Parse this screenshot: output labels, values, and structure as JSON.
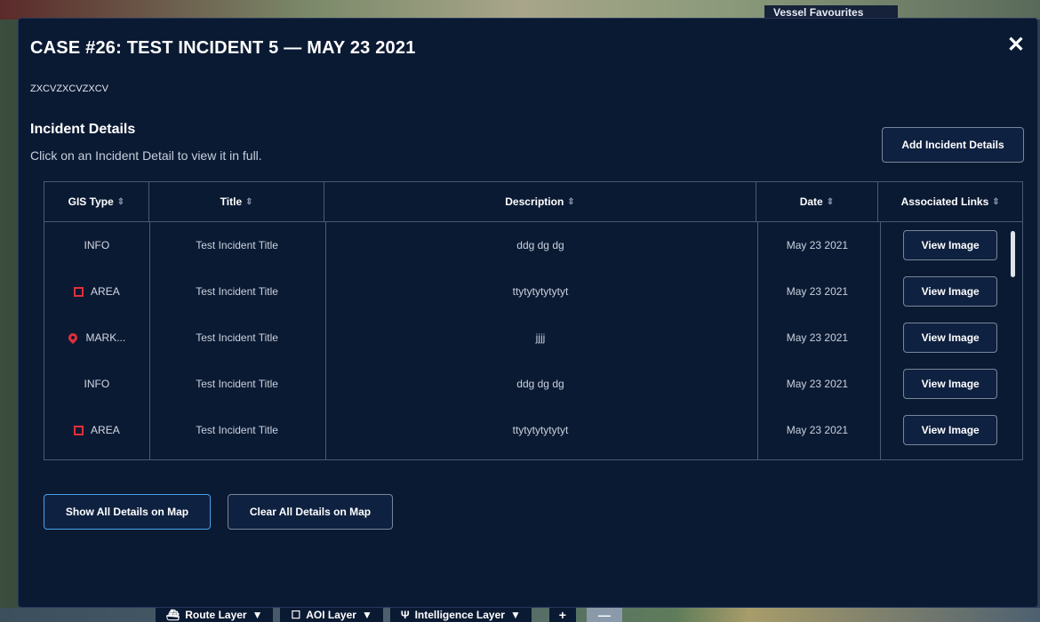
{
  "vessel_tab": "Vessel Favourites",
  "modal": {
    "title": "CASE #26: TEST INCIDENT 5 — MAY 23 2021",
    "subtitle": "ZXCVZXCVZXCV",
    "close_glyph": "✕"
  },
  "section": {
    "title": "Incident Details",
    "hint": "Click on an Incident Detail to view it in full.",
    "add_button": "Add Incident Details"
  },
  "table": {
    "columns": [
      "GIS Type",
      "Title",
      "Description",
      "Date",
      "Associated Links"
    ],
    "sort_glyph": "⇕",
    "rows": [
      {
        "gis": "INFO",
        "icon": "",
        "title": "Test Incident Title",
        "description": "ddg dg dg",
        "date": "May 23 2021",
        "link": "View Image"
      },
      {
        "gis": "AREA",
        "icon": "area-icon",
        "title": "Test Incident Title",
        "description": "ttytytytytytyt",
        "date": "May 23 2021",
        "link": "View Image"
      },
      {
        "gis": "MARK...",
        "icon": "map-pin-icon",
        "title": "Test Incident Title",
        "description": "jjjj",
        "date": "May 23 2021",
        "link": "View Image"
      },
      {
        "gis": "INFO",
        "icon": "",
        "title": "Test Incident Title",
        "description": "ddg dg dg",
        "date": "May 23 2021",
        "link": "View Image"
      },
      {
        "gis": "AREA",
        "icon": "area-icon",
        "title": "Test Incident Title",
        "description": "ttytytytytytyt",
        "date": "May 23 2021",
        "link": "View Image"
      }
    ]
  },
  "actions": {
    "show_all": "Show All Details on Map",
    "clear_all": "Clear All Details on Map"
  },
  "bottom_bar": {
    "route_layer": "Route Layer",
    "aoi_layer": "AOI Layer",
    "intel_layer": "Intelligence Layer",
    "dropdown_glyph": "▼",
    "plus": "+",
    "minus": "—"
  },
  "colors": {
    "modal_bg": "#0b1a33",
    "accent_red": "#e0303a",
    "focus_blue": "#4aa0e8"
  }
}
